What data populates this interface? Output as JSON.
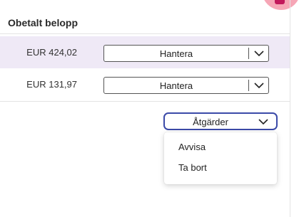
{
  "table": {
    "column_header": "Obetalt belopp",
    "rows": [
      {
        "amount": "EUR 424,02",
        "action_label": "Hantera"
      },
      {
        "amount": "EUR 131,97",
        "action_label": "Hantera"
      }
    ]
  },
  "actions_dropdown": {
    "label": "Åtgärder",
    "items": [
      "Avvisa",
      "Ta bort"
    ]
  },
  "colors": {
    "selected_row_bg": "#efe9f6",
    "accent_border": "#3b4aa8",
    "avatar": "#f6a6b6"
  }
}
